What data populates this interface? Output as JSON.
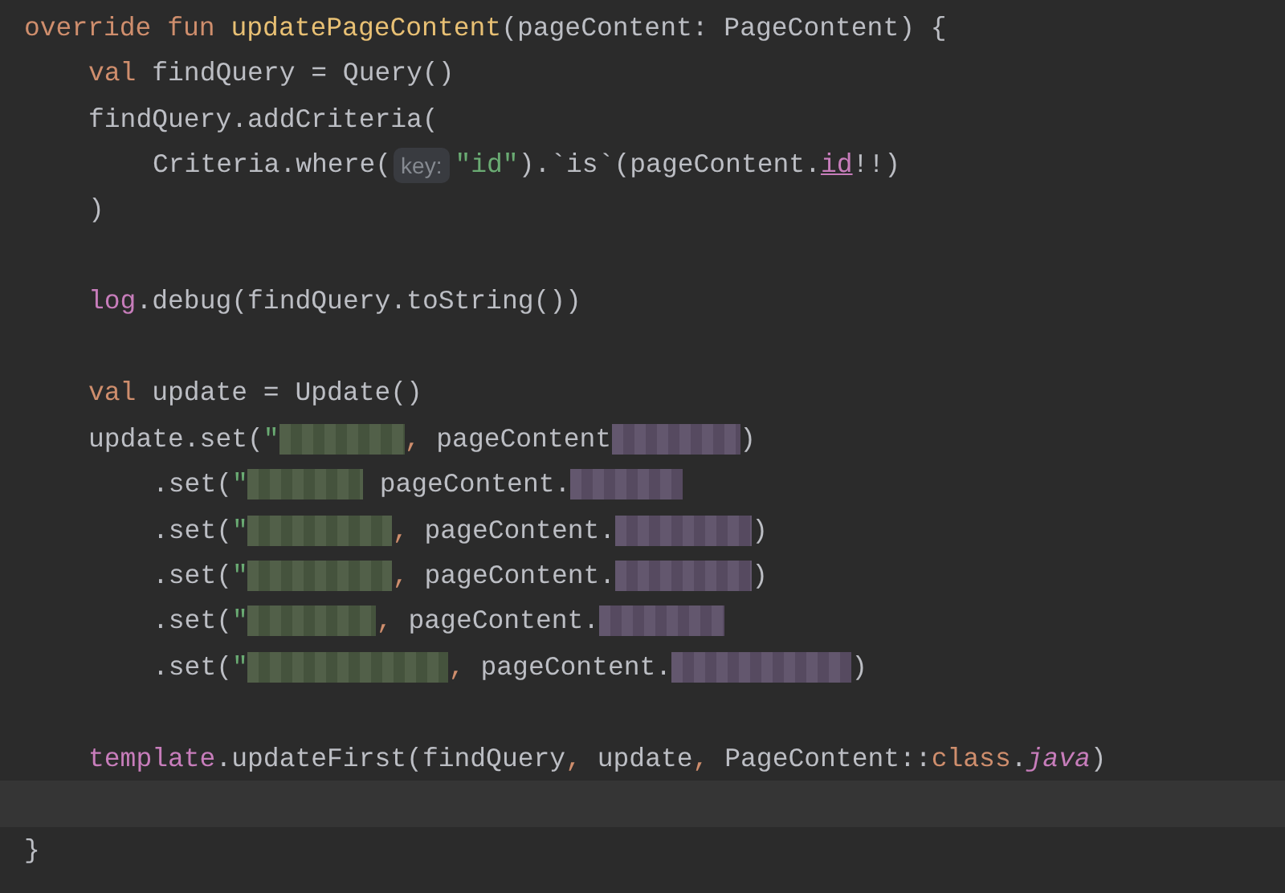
{
  "editor": {
    "lines": [
      {
        "kind": "code",
        "tokens": [
          {
            "kind": "keyword",
            "text": "override fun "
          },
          {
            "kind": "function",
            "text": "updatePageContent"
          },
          {
            "kind": "plain",
            "text": "(pageContent: PageContent) {"
          }
        ]
      },
      {
        "kind": "code",
        "tokens": [
          {
            "kind": "keyword",
            "text": "val "
          },
          {
            "kind": "plain",
            "text": "findQuery = Query()"
          }
        ]
      },
      {
        "kind": "code",
        "tokens": [
          {
            "kind": "plain",
            "text": "findQuery.addCriteria("
          }
        ]
      },
      {
        "kind": "code",
        "tokens": [
          {
            "kind": "plain",
            "text": "Criteria.where("
          },
          {
            "kind": "hint",
            "text": "key:"
          },
          {
            "kind": "string",
            "text": "\"id\""
          },
          {
            "kind": "plain",
            "text": ").`is`(pageContent."
          },
          {
            "kind": "field",
            "text": "id"
          },
          {
            "kind": "plain",
            "text": "!!)"
          }
        ]
      },
      {
        "kind": "code",
        "tokens": [
          {
            "kind": "plain",
            "text": ")"
          }
        ]
      },
      {
        "kind": "blank"
      },
      {
        "kind": "code",
        "tokens": [
          {
            "kind": "member",
            "text": "log"
          },
          {
            "kind": "plain",
            "text": ".debug(findQuery.toString())"
          }
        ]
      },
      {
        "kind": "blank"
      },
      {
        "kind": "code",
        "tokens": [
          {
            "kind": "keyword",
            "text": "val "
          },
          {
            "kind": "plain",
            "text": "update = Update()"
          }
        ]
      },
      {
        "kind": "code",
        "tokens": [
          {
            "kind": "plain",
            "text": "update.set("
          },
          {
            "kind": "string",
            "text": "\""
          },
          {
            "kind": "redacted-string"
          },
          {
            "kind": "punct",
            "text": ", "
          },
          {
            "kind": "plain",
            "text": "pageContent"
          },
          {
            "kind": "redacted-member"
          },
          {
            "kind": "plain",
            "text": ")"
          }
        ]
      },
      {
        "kind": "code",
        "tokens": [
          {
            "kind": "plain",
            "text": ".set("
          },
          {
            "kind": "string",
            "text": "\""
          },
          {
            "kind": "redacted-string"
          },
          {
            "kind": "plain",
            "text": " pageContent."
          },
          {
            "kind": "redacted-member"
          }
        ]
      },
      {
        "kind": "code",
        "tokens": [
          {
            "kind": "plain",
            "text": ".set("
          },
          {
            "kind": "string",
            "text": "\""
          },
          {
            "kind": "redacted-string"
          },
          {
            "kind": "punct",
            "text": ", "
          },
          {
            "kind": "plain",
            "text": "pageContent."
          },
          {
            "kind": "redacted-member"
          },
          {
            "kind": "plain",
            "text": ")"
          }
        ]
      },
      {
        "kind": "code",
        "tokens": [
          {
            "kind": "plain",
            "text": ".set("
          },
          {
            "kind": "string",
            "text": "\""
          },
          {
            "kind": "redacted-string"
          },
          {
            "kind": "punct",
            "text": ", "
          },
          {
            "kind": "plain",
            "text": "pageContent."
          },
          {
            "kind": "redacted-member"
          },
          {
            "kind": "plain",
            "text": ")"
          }
        ]
      },
      {
        "kind": "code",
        "tokens": [
          {
            "kind": "plain",
            "text": ".set("
          },
          {
            "kind": "string",
            "text": "\""
          },
          {
            "kind": "redacted-string"
          },
          {
            "kind": "punct",
            "text": ", "
          },
          {
            "kind": "plain",
            "text": "pageContent."
          },
          {
            "kind": "redacted-member"
          }
        ]
      },
      {
        "kind": "code",
        "tokens": [
          {
            "kind": "plain",
            "text": ".set("
          },
          {
            "kind": "string",
            "text": "\""
          },
          {
            "kind": "redacted-string"
          },
          {
            "kind": "punct",
            "text": ", "
          },
          {
            "kind": "plain",
            "text": "pageContent."
          },
          {
            "kind": "redacted-member"
          },
          {
            "kind": "plain",
            "text": ")"
          }
        ]
      },
      {
        "kind": "blank"
      },
      {
        "kind": "code",
        "tokens": [
          {
            "kind": "member",
            "text": "template"
          },
          {
            "kind": "plain",
            "text": ".updateFirst(findQuery"
          },
          {
            "kind": "punct",
            "text": ", "
          },
          {
            "kind": "plain",
            "text": "update"
          },
          {
            "kind": "punct",
            "text": ", "
          },
          {
            "kind": "plain",
            "text": "PageContent::"
          },
          {
            "kind": "keyword",
            "text": "class"
          },
          {
            "kind": "plain",
            "text": "."
          },
          {
            "kind": "italic",
            "text": "java"
          },
          {
            "kind": "plain",
            "text": ")"
          }
        ]
      },
      {
        "kind": "caret-line"
      },
      {
        "kind": "code",
        "tokens": [
          {
            "kind": "plain",
            "text": "}"
          }
        ]
      }
    ]
  }
}
